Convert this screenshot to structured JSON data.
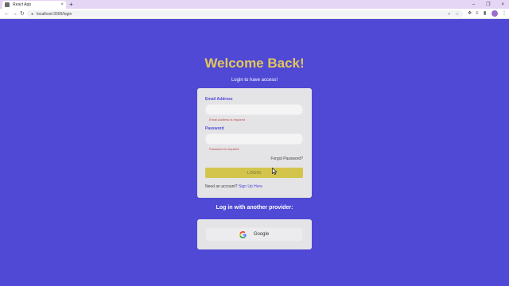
{
  "browser": {
    "tab_title": "React App",
    "tab_close": "×",
    "new_tab": "+",
    "window_controls": {
      "minimize": "–",
      "maximize": "❐",
      "close": "×"
    },
    "nav": {
      "back": "←",
      "forward": "→",
      "reload": "↻"
    },
    "url": "localhost:3000/login",
    "icons": [
      "lock-icon",
      "share-icon",
      "star-icon",
      "extensions-icon",
      "sidebar-icon",
      "profile-avatar",
      "menu-icon"
    ]
  },
  "page": {
    "title": "Welcome Back!",
    "subtitle": "Login to have access!"
  },
  "login_form": {
    "email_label": "Email Address",
    "email_value": "",
    "email_error": "Email address is required",
    "password_label": "Password",
    "password_value": "",
    "password_error": "Password is required",
    "forgot_password": "Forgot Password?",
    "login_button": "LOGIN",
    "signup_prompt": "Need an account?",
    "signup_link": "Sign Up Here"
  },
  "providers": {
    "heading": "Log in with another provider:",
    "google_label": "Google"
  },
  "colors": {
    "background": "#4f49d6",
    "title": "#e3c75a",
    "card": "#e4e4e6",
    "login_button": "#d3c54c",
    "error": "#c0474f"
  }
}
